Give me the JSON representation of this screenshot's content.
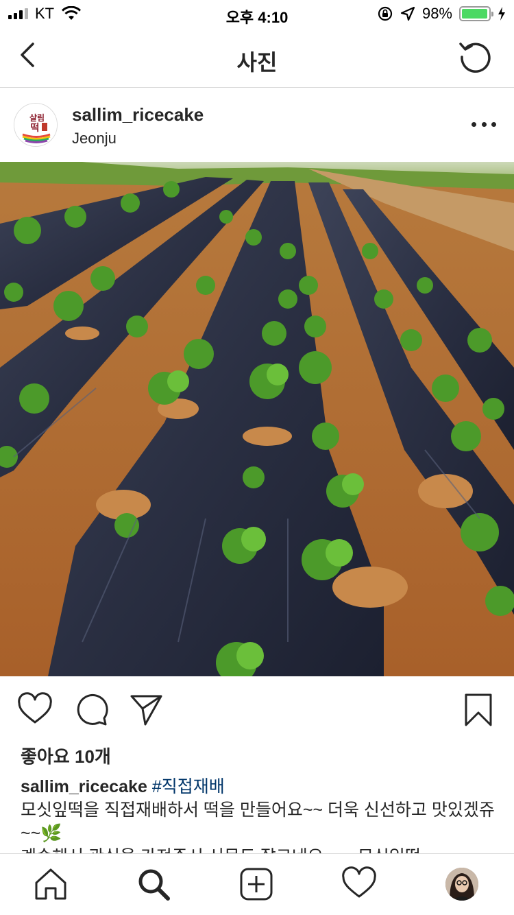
{
  "status_bar": {
    "carrier": "KT",
    "time": "오후 4:10",
    "battery_percent": "98%",
    "battery_level": 0.98
  },
  "nav": {
    "title": "사진",
    "back_icon": "chevron-left-icon",
    "refresh_icon": "refresh-icon"
  },
  "post": {
    "username": "sallim_ricecake",
    "location": "Jeonju",
    "avatar_logo_text": "살림떡",
    "more_icon": "more-horizontal-icon"
  },
  "actions": {
    "like_icon": "heart-icon",
    "comment_icon": "comment-icon",
    "share_icon": "paper-plane-icon",
    "save_icon": "bookmark-icon"
  },
  "likes": "좋아요 10개",
  "caption": {
    "username": "sallim_ricecake",
    "hashtag": "#직접재배",
    "text": "모싯잎떡을 직접재배하서 떡을 만들어요~~ 더욱 신선하고 맛있겠쥬~~🌿",
    "more_text": "계속해서 관심을 가져주시 서문도 잘그네요 ~ ~ 모싯잎떡"
  },
  "tab_bar": {
    "home_icon": "home-icon",
    "search_icon": "search-icon",
    "add_icon": "add-post-icon",
    "activity_icon": "heart-icon",
    "profile_icon": "profile-avatar"
  },
  "colors": {
    "text": "#262626",
    "hashtag": "#003569",
    "border": "#dbdbdb",
    "battery": "#4cd964"
  }
}
